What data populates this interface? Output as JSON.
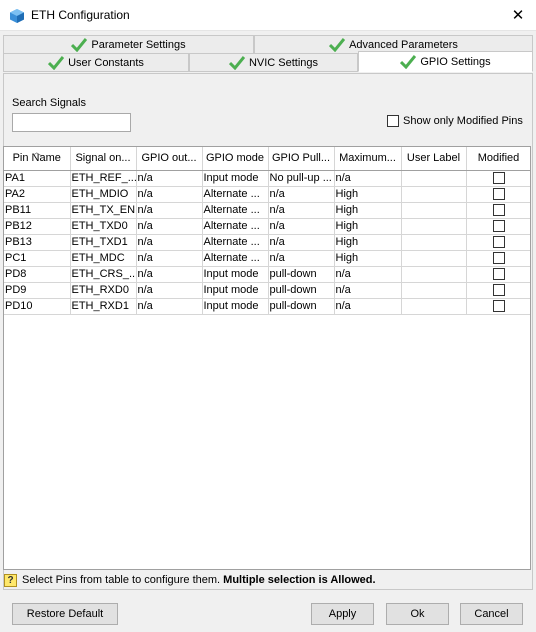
{
  "window": {
    "title": "ETH Configuration",
    "close_symbol": "✕"
  },
  "tabs": {
    "row1": [
      {
        "label": "Parameter Settings"
      },
      {
        "label": "Advanced Parameters"
      }
    ],
    "row2": [
      {
        "label": "User Constants"
      },
      {
        "label": "NVIC Settings"
      },
      {
        "label": "GPIO Settings"
      }
    ],
    "active": "GPIO Settings",
    "check_color": "#4caf50"
  },
  "search": {
    "label": "Search Signals",
    "value": ""
  },
  "show_modified": {
    "label": "Show only Modified Pins",
    "checked": false
  },
  "table": {
    "headers": [
      "Pin Name",
      "Signal on...",
      "GPIO out...",
      "GPIO mode",
      "GPIO Pull...",
      "Maximum...",
      "User Label",
      "Modified"
    ],
    "rows": [
      [
        "PA1",
        "ETH_REF_...",
        "n/a",
        "Input mode",
        "No pull-up ...",
        "n/a",
        ""
      ],
      [
        "PA2",
        "ETH_MDIO",
        "n/a",
        "Alternate ...",
        "n/a",
        "High",
        ""
      ],
      [
        "PB11",
        "ETH_TX_EN",
        "n/a",
        "Alternate ...",
        "n/a",
        "High",
        ""
      ],
      [
        "PB12",
        "ETH_TXD0",
        "n/a",
        "Alternate ...",
        "n/a",
        "High",
        ""
      ],
      [
        "PB13",
        "ETH_TXD1",
        "n/a",
        "Alternate ...",
        "n/a",
        "High",
        ""
      ],
      [
        "PC1",
        "ETH_MDC",
        "n/a",
        "Alternate ...",
        "n/a",
        "High",
        ""
      ],
      [
        "PD8",
        "ETH_CRS_...",
        "n/a",
        "Input mode",
        "pull-down",
        "n/a",
        ""
      ],
      [
        "PD9",
        "ETH_RXD0",
        "n/a",
        "Input mode",
        "pull-down",
        "n/a",
        ""
      ],
      [
        "PD10",
        "ETH_RXD1",
        "n/a",
        "Input mode",
        "pull-down",
        "n/a",
        ""
      ]
    ]
  },
  "hint": {
    "icon": "?",
    "text": "Select Pins from table to configure them.",
    "bold": "Multiple selection is Allowed."
  },
  "buttons": {
    "restore": "Restore Default",
    "apply": "Apply",
    "ok": "Ok",
    "cancel": "Cancel"
  }
}
